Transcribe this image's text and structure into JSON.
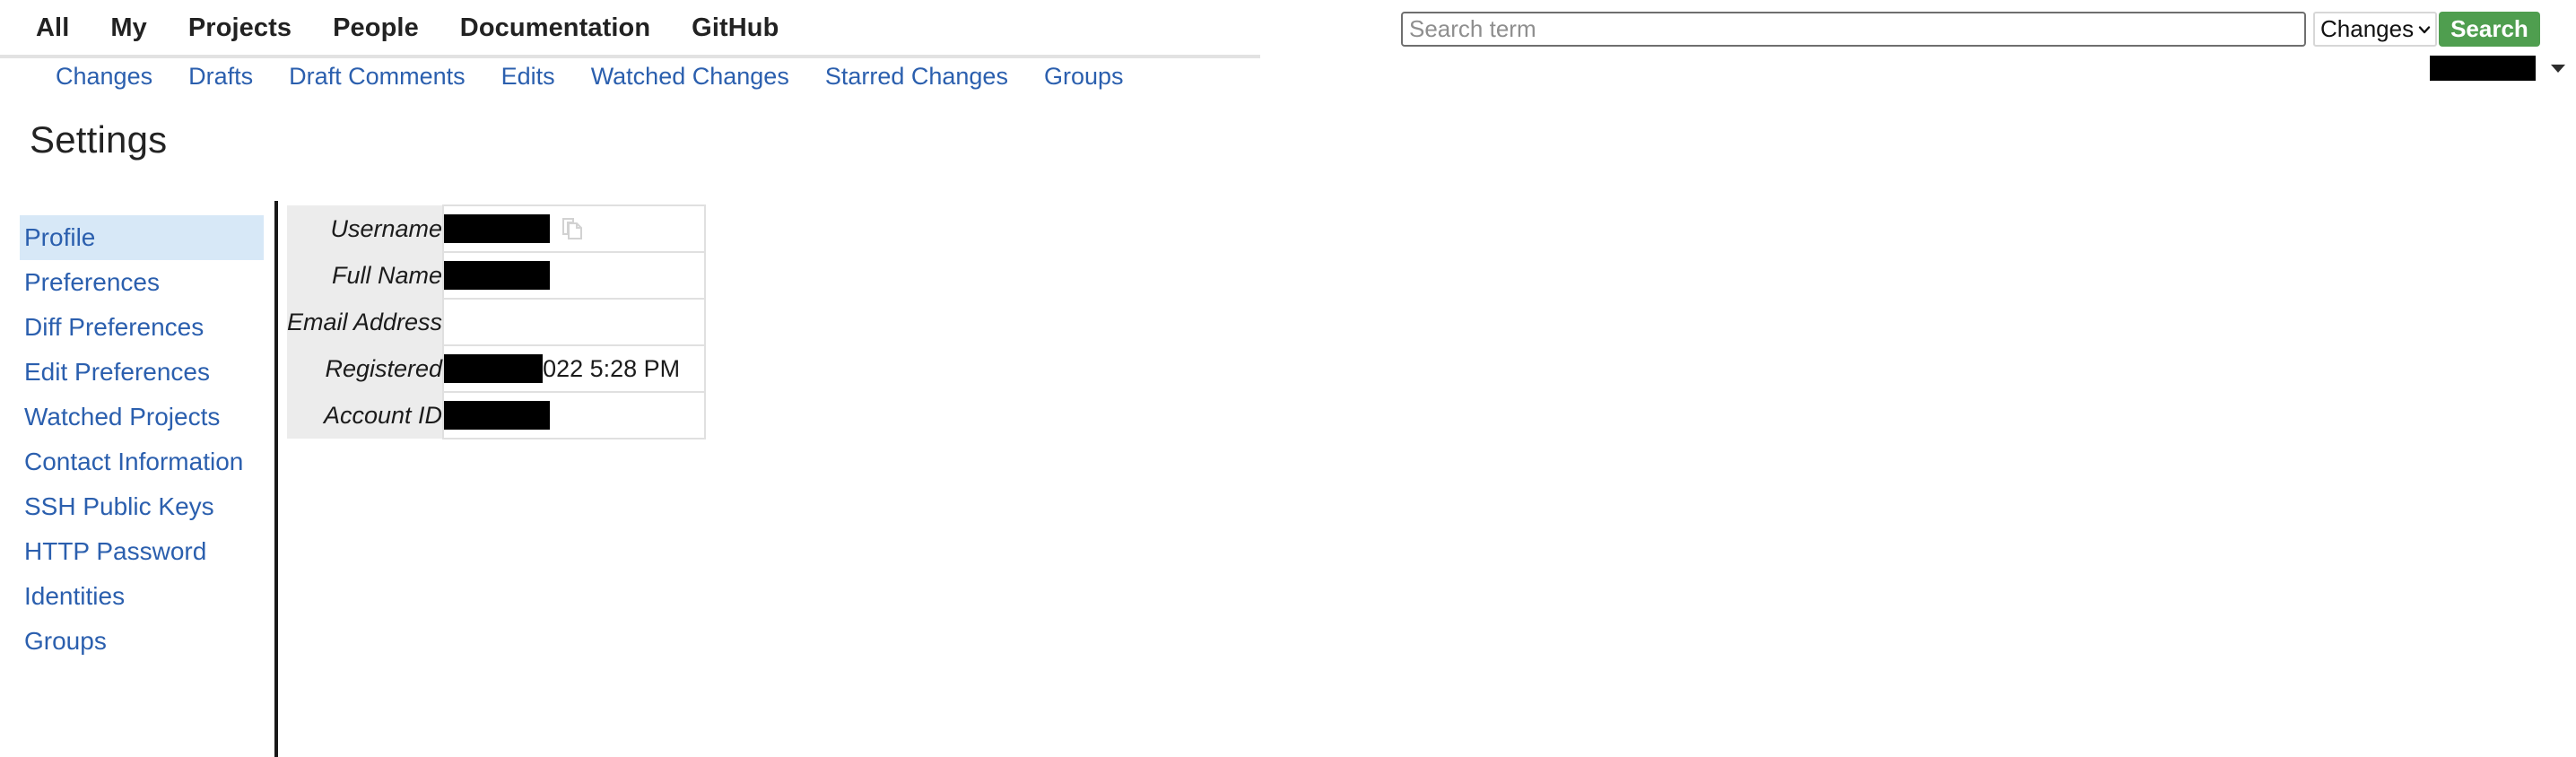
{
  "header": {
    "main_nav": [
      {
        "label": "All"
      },
      {
        "label": "My"
      },
      {
        "label": "Projects"
      },
      {
        "label": "People"
      },
      {
        "label": "Documentation"
      },
      {
        "label": "GitHub"
      }
    ],
    "sub_nav": [
      {
        "label": "Changes"
      },
      {
        "label": "Drafts"
      },
      {
        "label": "Draft Comments"
      },
      {
        "label": "Edits"
      },
      {
        "label": "Watched Changes"
      },
      {
        "label": "Starred Changes"
      },
      {
        "label": "Groups"
      }
    ],
    "search": {
      "placeholder": "Search term",
      "value": "",
      "scope_selected": "Changes",
      "scope_options": [
        "Changes"
      ],
      "button_label": "Search"
    },
    "account": {
      "name": "",
      "name_redacted": true,
      "caret_icon": "chevron-down-icon"
    }
  },
  "page": {
    "title": "Settings"
  },
  "sidebar": {
    "items": [
      {
        "label": "Profile",
        "active": true
      },
      {
        "label": "Preferences",
        "active": false
      },
      {
        "label": "Diff Preferences",
        "active": false
      },
      {
        "label": "Edit Preferences",
        "active": false
      },
      {
        "label": "Watched Projects",
        "active": false
      },
      {
        "label": "Contact Information",
        "active": false
      },
      {
        "label": "SSH Public Keys",
        "active": false
      },
      {
        "label": "HTTP Password",
        "active": false
      },
      {
        "label": "Identities",
        "active": false
      },
      {
        "label": "Groups",
        "active": false
      }
    ]
  },
  "profile": {
    "rows": [
      {
        "label": "Username",
        "value": "",
        "redacted": true,
        "has_copy_icon": true
      },
      {
        "label": "Full Name",
        "value": "",
        "redacted": true,
        "has_copy_icon": false
      },
      {
        "label": "Email Address",
        "value": "",
        "redacted": false,
        "has_copy_icon": false
      },
      {
        "label": "Registered",
        "value": "022 5:28 PM",
        "redacted": true,
        "has_copy_icon": false
      },
      {
        "label": "Account ID",
        "value": "",
        "redacted": true,
        "has_copy_icon": false
      }
    ]
  },
  "colors": {
    "link_blue": "#2b5fae",
    "active_highlight": "#d7e8f7",
    "search_green": "#4f9e4f",
    "label_background": "#ececec",
    "divider": "#191919"
  }
}
